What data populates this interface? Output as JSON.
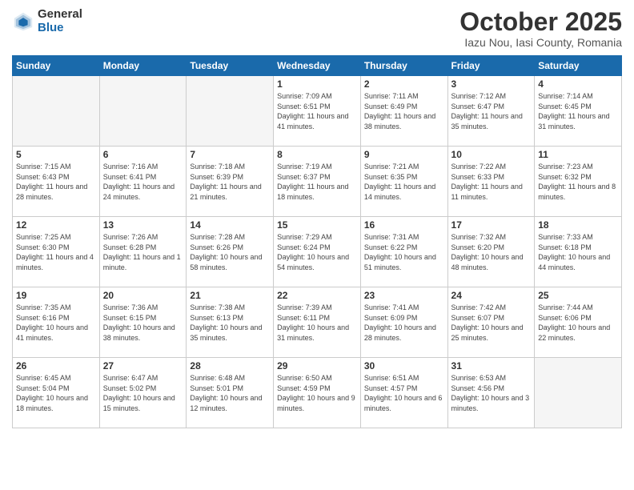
{
  "header": {
    "logo_general": "General",
    "logo_blue": "Blue",
    "month_title": "October 2025",
    "location": "Iazu Nou, Iasi County, Romania"
  },
  "days_of_week": [
    "Sunday",
    "Monday",
    "Tuesday",
    "Wednesday",
    "Thursday",
    "Friday",
    "Saturday"
  ],
  "weeks": [
    [
      {
        "day": "",
        "info": ""
      },
      {
        "day": "",
        "info": ""
      },
      {
        "day": "",
        "info": ""
      },
      {
        "day": "1",
        "info": "Sunrise: 7:09 AM\nSunset: 6:51 PM\nDaylight: 11 hours and 41 minutes."
      },
      {
        "day": "2",
        "info": "Sunrise: 7:11 AM\nSunset: 6:49 PM\nDaylight: 11 hours and 38 minutes."
      },
      {
        "day": "3",
        "info": "Sunrise: 7:12 AM\nSunset: 6:47 PM\nDaylight: 11 hours and 35 minutes."
      },
      {
        "day": "4",
        "info": "Sunrise: 7:14 AM\nSunset: 6:45 PM\nDaylight: 11 hours and 31 minutes."
      }
    ],
    [
      {
        "day": "5",
        "info": "Sunrise: 7:15 AM\nSunset: 6:43 PM\nDaylight: 11 hours and 28 minutes."
      },
      {
        "day": "6",
        "info": "Sunrise: 7:16 AM\nSunset: 6:41 PM\nDaylight: 11 hours and 24 minutes."
      },
      {
        "day": "7",
        "info": "Sunrise: 7:18 AM\nSunset: 6:39 PM\nDaylight: 11 hours and 21 minutes."
      },
      {
        "day": "8",
        "info": "Sunrise: 7:19 AM\nSunset: 6:37 PM\nDaylight: 11 hours and 18 minutes."
      },
      {
        "day": "9",
        "info": "Sunrise: 7:21 AM\nSunset: 6:35 PM\nDaylight: 11 hours and 14 minutes."
      },
      {
        "day": "10",
        "info": "Sunrise: 7:22 AM\nSunset: 6:33 PM\nDaylight: 11 hours and 11 minutes."
      },
      {
        "day": "11",
        "info": "Sunrise: 7:23 AM\nSunset: 6:32 PM\nDaylight: 11 hours and 8 minutes."
      }
    ],
    [
      {
        "day": "12",
        "info": "Sunrise: 7:25 AM\nSunset: 6:30 PM\nDaylight: 11 hours and 4 minutes."
      },
      {
        "day": "13",
        "info": "Sunrise: 7:26 AM\nSunset: 6:28 PM\nDaylight: 11 hours and 1 minute."
      },
      {
        "day": "14",
        "info": "Sunrise: 7:28 AM\nSunset: 6:26 PM\nDaylight: 10 hours and 58 minutes."
      },
      {
        "day": "15",
        "info": "Sunrise: 7:29 AM\nSunset: 6:24 PM\nDaylight: 10 hours and 54 minutes."
      },
      {
        "day": "16",
        "info": "Sunrise: 7:31 AM\nSunset: 6:22 PM\nDaylight: 10 hours and 51 minutes."
      },
      {
        "day": "17",
        "info": "Sunrise: 7:32 AM\nSunset: 6:20 PM\nDaylight: 10 hours and 48 minutes."
      },
      {
        "day": "18",
        "info": "Sunrise: 7:33 AM\nSunset: 6:18 PM\nDaylight: 10 hours and 44 minutes."
      }
    ],
    [
      {
        "day": "19",
        "info": "Sunrise: 7:35 AM\nSunset: 6:16 PM\nDaylight: 10 hours and 41 minutes."
      },
      {
        "day": "20",
        "info": "Sunrise: 7:36 AM\nSunset: 6:15 PM\nDaylight: 10 hours and 38 minutes."
      },
      {
        "day": "21",
        "info": "Sunrise: 7:38 AM\nSunset: 6:13 PM\nDaylight: 10 hours and 35 minutes."
      },
      {
        "day": "22",
        "info": "Sunrise: 7:39 AM\nSunset: 6:11 PM\nDaylight: 10 hours and 31 minutes."
      },
      {
        "day": "23",
        "info": "Sunrise: 7:41 AM\nSunset: 6:09 PM\nDaylight: 10 hours and 28 minutes."
      },
      {
        "day": "24",
        "info": "Sunrise: 7:42 AM\nSunset: 6:07 PM\nDaylight: 10 hours and 25 minutes."
      },
      {
        "day": "25",
        "info": "Sunrise: 7:44 AM\nSunset: 6:06 PM\nDaylight: 10 hours and 22 minutes."
      }
    ],
    [
      {
        "day": "26",
        "info": "Sunrise: 6:45 AM\nSunset: 5:04 PM\nDaylight: 10 hours and 18 minutes."
      },
      {
        "day": "27",
        "info": "Sunrise: 6:47 AM\nSunset: 5:02 PM\nDaylight: 10 hours and 15 minutes."
      },
      {
        "day": "28",
        "info": "Sunrise: 6:48 AM\nSunset: 5:01 PM\nDaylight: 10 hours and 12 minutes."
      },
      {
        "day": "29",
        "info": "Sunrise: 6:50 AM\nSunset: 4:59 PM\nDaylight: 10 hours and 9 minutes."
      },
      {
        "day": "30",
        "info": "Sunrise: 6:51 AM\nSunset: 4:57 PM\nDaylight: 10 hours and 6 minutes."
      },
      {
        "day": "31",
        "info": "Sunrise: 6:53 AM\nSunset: 4:56 PM\nDaylight: 10 hours and 3 minutes."
      },
      {
        "day": "",
        "info": ""
      }
    ]
  ]
}
